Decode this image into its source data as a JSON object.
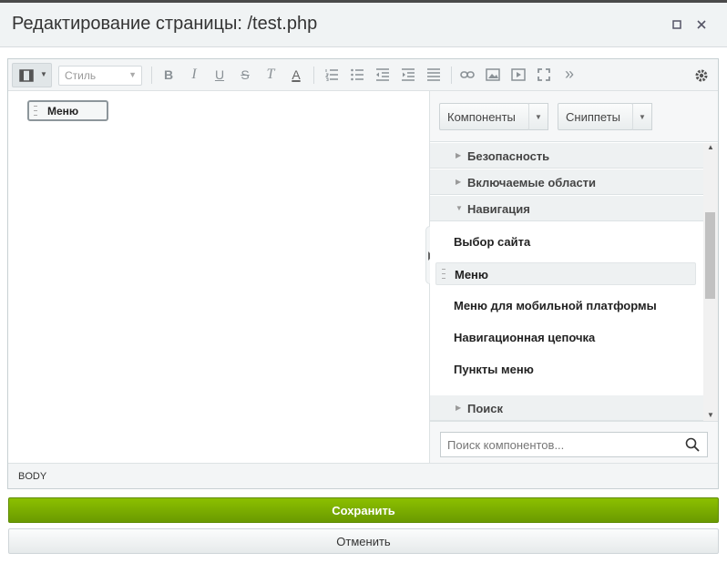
{
  "window": {
    "title": "Редактирование страницы: /test.php",
    "maximize_icon": "maximize-icon",
    "close_icon": "close-icon"
  },
  "toolbar": {
    "style_placeholder": "Стиль",
    "tools": [
      "view-mode-icon",
      "bold-icon",
      "italic-icon",
      "underline-icon",
      "strikethrough-icon",
      "remove-format-icon",
      "font-color-icon",
      "ordered-list-icon",
      "unordered-list-icon",
      "outdent-icon",
      "indent-icon",
      "align-icon",
      "link-icon",
      "image-icon",
      "video-icon",
      "fullscreen-icon",
      "more-icon",
      "settings-icon"
    ],
    "glyphs": {
      "bold": "B",
      "italic": "I",
      "underline": "U",
      "strike": "S",
      "clear": "T",
      "color": "A",
      "more": "»"
    }
  },
  "content": {
    "component_chip_label": "Меню"
  },
  "panel": {
    "tab_components": "Компоненты",
    "tab_snippets": "Сниппеты",
    "groups": [
      {
        "label": "Безопасность",
        "expanded": false
      },
      {
        "label": "Включаемые области",
        "expanded": false
      },
      {
        "label": "Навигация",
        "expanded": true
      },
      {
        "label": "Поиск",
        "expanded": false
      }
    ],
    "items": [
      {
        "label": "Выбор сайта",
        "selected": false
      },
      {
        "label": "Меню",
        "selected": true
      },
      {
        "label": "Меню для мобильной платформы",
        "selected": false
      },
      {
        "label": "Навигационная цепочка",
        "selected": false
      },
      {
        "label": "Пункты меню",
        "selected": false
      }
    ],
    "search_placeholder": "Поиск компонентов..."
  },
  "statusbar": {
    "path": "BODY"
  },
  "actions": {
    "save_label": "Сохранить",
    "cancel_label": "Отменить"
  },
  "colors": {
    "save_button": "#7aad00",
    "title_bar": "#f0f3f4"
  }
}
